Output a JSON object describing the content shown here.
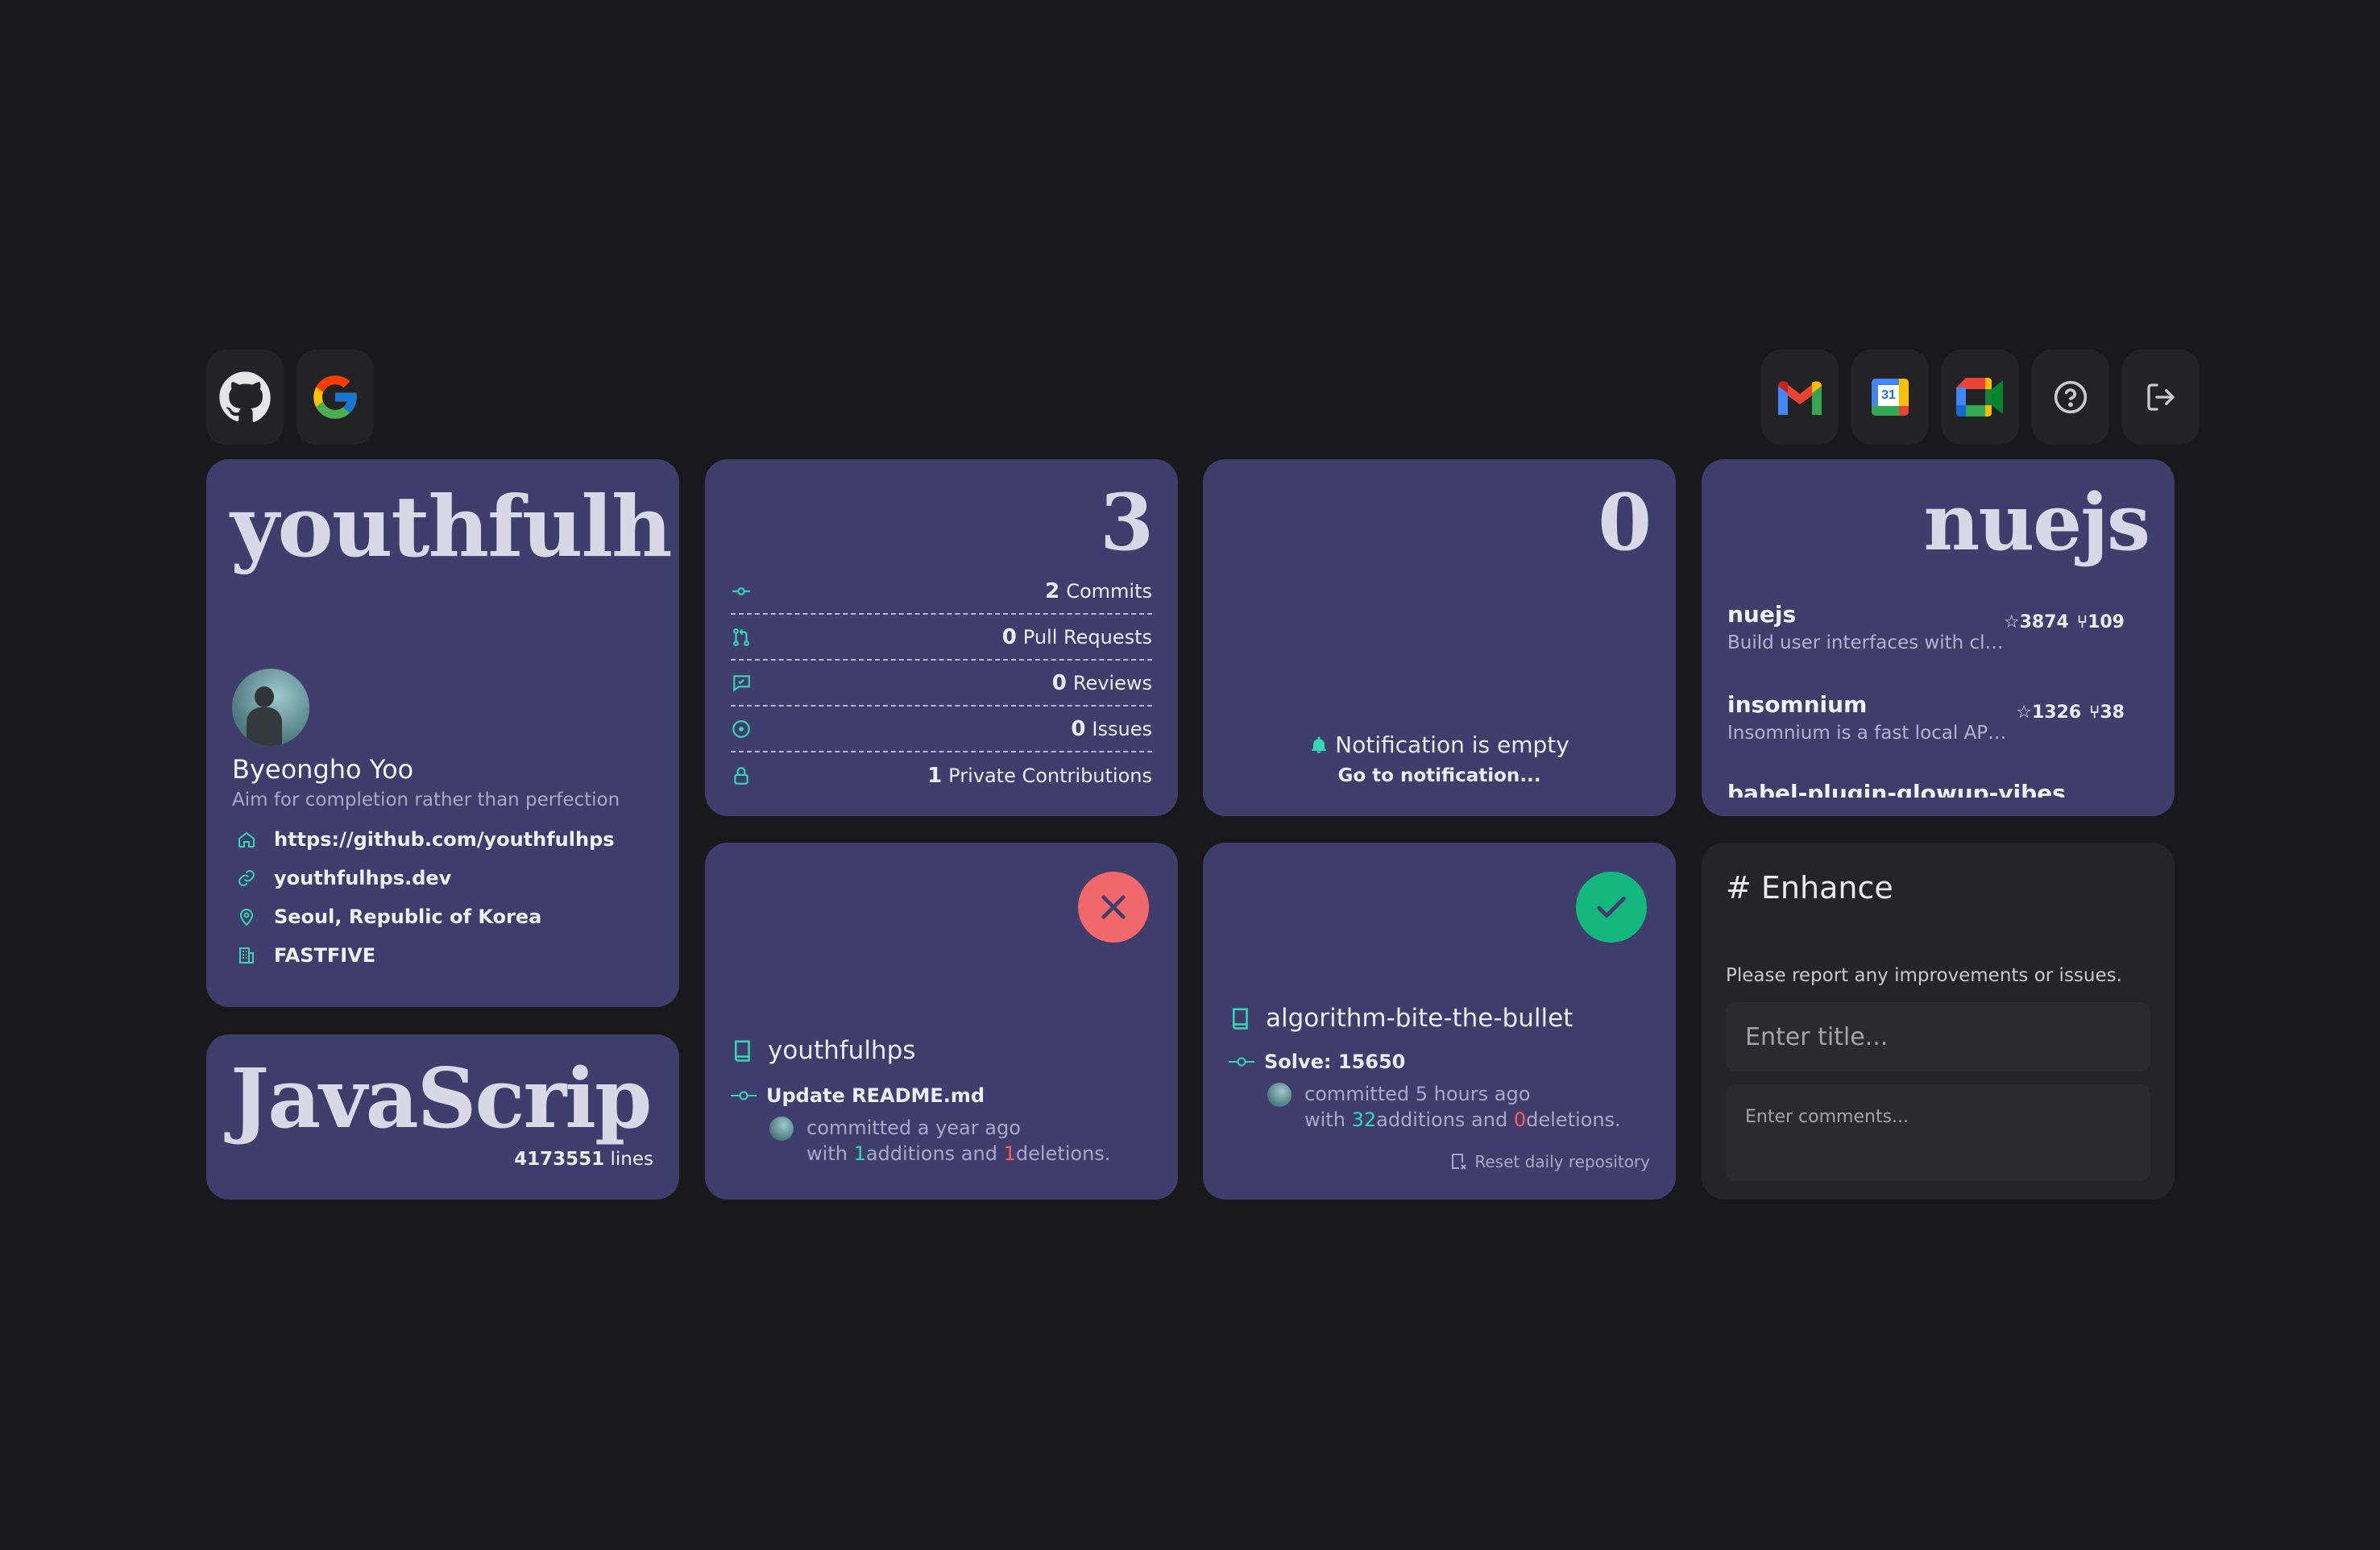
{
  "top_left_icons": [
    "github-icon",
    "google-icon"
  ],
  "top_right_icons": [
    "gmail-icon",
    "google-calendar-icon",
    "google-meet-icon",
    "help-icon",
    "logout-icon"
  ],
  "calendar_day": "31",
  "profile": {
    "username": "youthfulh",
    "name": "Byeongho Yoo",
    "bio": "Aim for completion rather than perfection",
    "github_url": "https://github.com/youthfulhps",
    "website": "youthfulhps.dev",
    "location": "Seoul, Republic of Korea",
    "company": "FASTFIVE"
  },
  "language": {
    "name": "JavaScrip",
    "lines": "4173551",
    "lines_label": "lines"
  },
  "stats": {
    "total": "3",
    "rows": [
      {
        "icon": "commit-icon",
        "value": "2",
        "label": "Commits"
      },
      {
        "icon": "pull-request-icon",
        "value": "0",
        "label": "Pull Requests"
      },
      {
        "icon": "review-icon",
        "value": "0",
        "label": "Reviews"
      },
      {
        "icon": "issue-icon",
        "value": "0",
        "label": "Issues"
      },
      {
        "icon": "lock-icon",
        "value": "1",
        "label": "Private Contributions"
      }
    ]
  },
  "notifications": {
    "count": "0",
    "empty_text": "Notification is empty",
    "link": "Go to notification..."
  },
  "repos": {
    "title": "nuejs",
    "items": [
      {
        "name": "nuejs",
        "desc": "Build user interfaces with clea...",
        "stars": "3874",
        "forks": "109"
      },
      {
        "name": "insomnium",
        "desc": "Insomnium is a fast local API t...",
        "stars": "1326",
        "forks": "38"
      },
      {
        "name": "babel-plugin-glowup-vibes",
        "desc": "",
        "stars": "",
        "forks": ""
      }
    ]
  },
  "last_commit": {
    "status": "failed",
    "repo": "youthfulhps",
    "message": "Update README.md",
    "time": "committed a year ago",
    "with": "with",
    "additions": "1",
    "additions_label": "additions and",
    "deletions": "1",
    "deletions_label": "deletions."
  },
  "daily": {
    "status": "success",
    "repo": "algorithm-bite-the-bullet",
    "message": "Solve: 15650",
    "time": "committed 5 hours ago",
    "with": "with",
    "additions": "32",
    "additions_label": "additions and",
    "deletions": "0",
    "deletions_label": "deletions.",
    "reset_label": "Reset daily repository"
  },
  "enhance": {
    "title": "# Enhance",
    "description": "Please report any improvements or issues.",
    "title_placeholder": "Enter title...",
    "comments_placeholder": "Enter comments..."
  }
}
